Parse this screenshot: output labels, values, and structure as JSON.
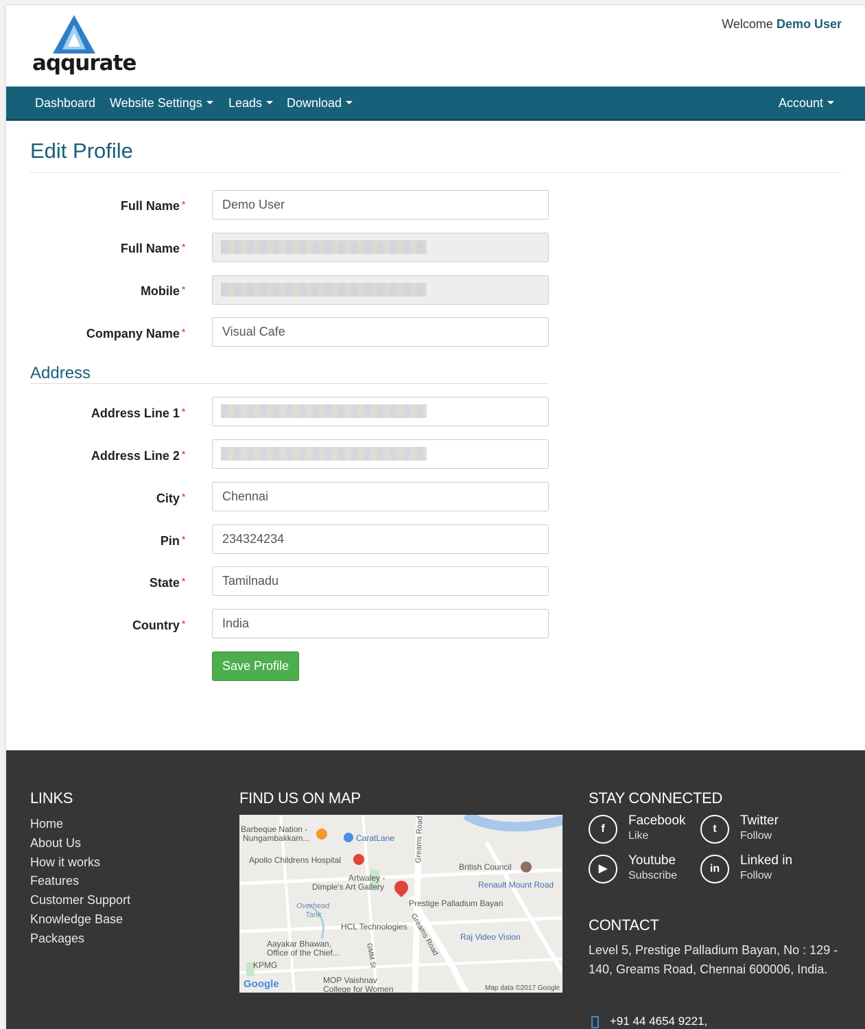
{
  "header": {
    "logo_text": "aqqurate",
    "welcome_prefix": "Welcome",
    "user_name": "Demo User"
  },
  "nav": {
    "dashboard": "Dashboard",
    "website_settings": "Website Settings",
    "leads": "Leads",
    "download": "Download",
    "account": "Account"
  },
  "page": {
    "title": "Edit Profile",
    "address_title": "Address",
    "save_label": "Save Profile"
  },
  "form": {
    "full_name_label": "Full Name",
    "full_name_value": "Demo User",
    "full_name2_label": "Full Name",
    "mobile_label": "Mobile",
    "company_label": "Company Name",
    "company_value": "Visual Cafe",
    "address1_label": "Address Line 1",
    "address2_label": "Address Line 2",
    "city_label": "City",
    "city_value": "Chennai",
    "pin_label": "Pin",
    "pin_value": "234324234",
    "state_label": "State",
    "state_value": "Tamilnadu",
    "country_label": "Country",
    "country_value": "India",
    "required_mark": "*"
  },
  "footer": {
    "links_title": "LINKS",
    "links": [
      "Home",
      "About Us",
      "How it works",
      "Features",
      "Customer Support",
      "Knowledge Base",
      "Packages"
    ],
    "map_title": "FIND US ON MAP",
    "map_labels": {
      "barbeque": "Barbeque Nation -",
      "nungambakkam": "Nungambakkam...",
      "caratlane": "CaratLane",
      "apollo": "Apollo Childrens Hospital",
      "artwaley": "Artwaley -",
      "dimples": "Dimple's Art Gallery",
      "british": "British Council",
      "renault": "Renault Mount Road",
      "prestige": "Prestige Palladium Bayan",
      "overhead": "Overhead",
      "tank": "Tank",
      "hcl": "HCL Technologies",
      "raj": "Raj Video Vision",
      "aayakar": "Aayakar Bhawan,",
      "office": "Office of the Chief...",
      "kpmg": "KPMG",
      "mop": "MOP Vaishnav",
      "college": "College for Women",
      "greams_road": "Greams Road",
      "greams_road2": "Greams Road",
      "gmm": "GMM St",
      "google": "Google",
      "map_data": "Map data ©2017 Google"
    },
    "connect_title": "STAY CONNECTED",
    "social": [
      {
        "name": "Facebook",
        "sub": "Like",
        "icon": "facebook-icon"
      },
      {
        "name": "Twitter",
        "sub": "Follow",
        "icon": "twitter-icon"
      },
      {
        "name": "Youtube",
        "sub": "Subscribe",
        "icon": "youtube-icon"
      },
      {
        "name": "Linked in",
        "sub": "Follow",
        "icon": "linkedin-icon"
      }
    ],
    "contact_title": "CONTACT",
    "contact_address": "Level 5, Prestige Palladium Bayan, No : 129 - 140, Greams Road, Chennai 600006, India.",
    "phone": "+91 44 4654 9221,"
  },
  "colors": {
    "brand": "#17607a",
    "save_button": "#4cae4c",
    "footer_bg": "#363636",
    "required": "#d9534f"
  }
}
